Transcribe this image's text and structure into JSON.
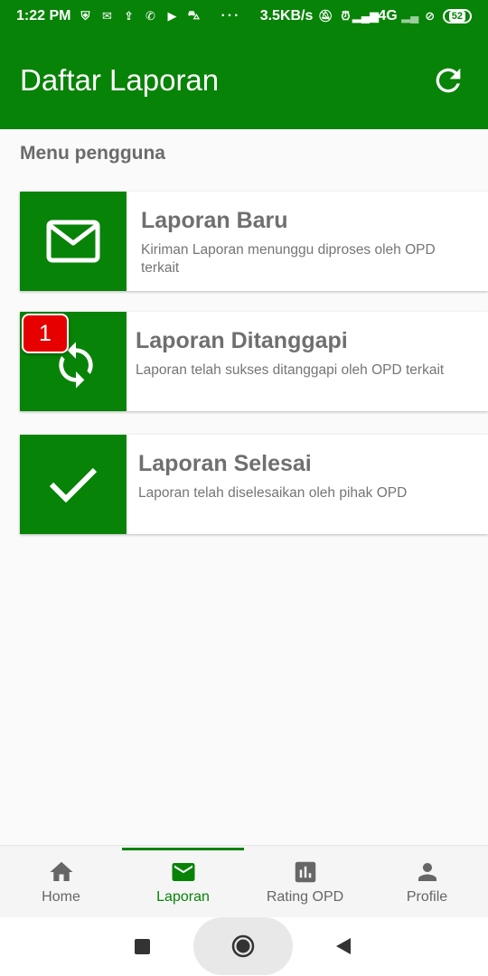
{
  "statusbar": {
    "time": "1:22 PM",
    "notification_icons": [
      "shield-icon",
      "mail-icon",
      "upload-icon",
      "whatsapp-icon",
      "youtube-icon",
      "shopping-icon"
    ],
    "more": "···",
    "network_speed": "3.5KB/s",
    "network_type": "4G",
    "battery": "52"
  },
  "appbar": {
    "title": "Daftar Laporan"
  },
  "section_title": "Menu pengguna",
  "cards": [
    {
      "title": "Laporan Baru",
      "description": "Kiriman Laporan menunggu diproses oleh OPD terkait",
      "icon": "mail-icon"
    },
    {
      "title": "Laporan Ditanggapi",
      "description": "Laporan telah sukses ditanggapi oleh OPD terkait",
      "icon": "sync-icon",
      "badge": "1"
    },
    {
      "title": "Laporan Selesai",
      "description": "Laporan telah diselesaikan oleh pihak OPD",
      "icon": "check-icon"
    }
  ],
  "bottom_nav": {
    "items": [
      {
        "label": "Home",
        "icon": "home-icon",
        "active": false
      },
      {
        "label": "Laporan",
        "icon": "mail-icon",
        "active": true
      },
      {
        "label": "Rating OPD",
        "icon": "chart-icon",
        "active": false
      },
      {
        "label": "Profile",
        "icon": "person-icon",
        "active": false
      }
    ]
  },
  "colors": {
    "primary": "#078307",
    "badge": "#e60000",
    "text_muted": "#6f6f6f"
  }
}
